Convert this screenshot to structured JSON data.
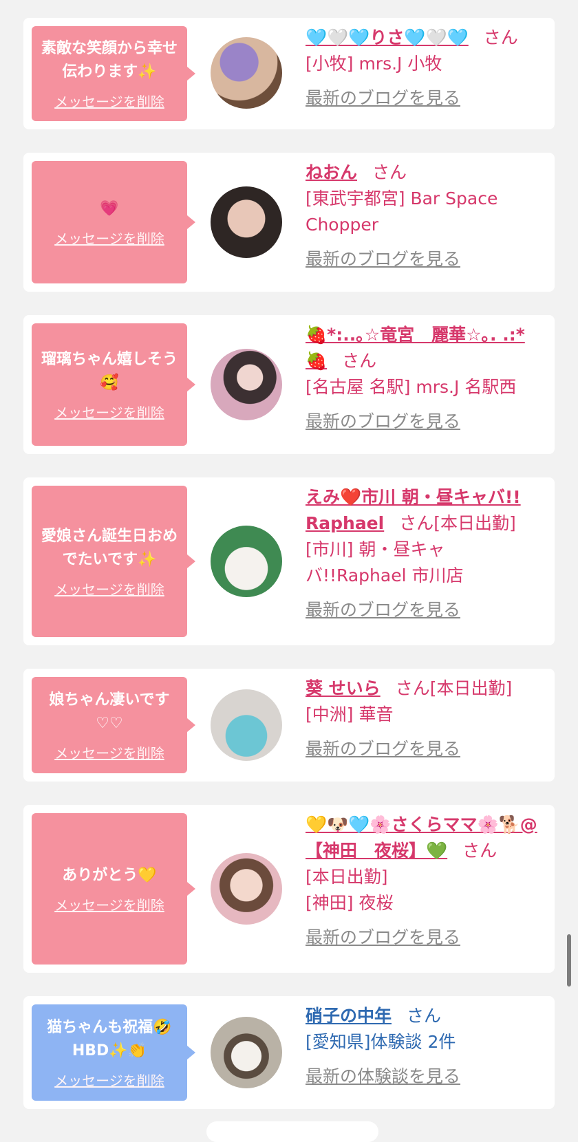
{
  "cards": [
    {
      "message": "素敵な笑顔から幸せ伝わります✨",
      "delete_label": "メッセージを削除",
      "name": "🩵🤍🩵りさ🩵🤍🩵",
      "san": "さん",
      "status": "",
      "shop": "[小牧] mrs.J 小牧",
      "blog_link": "最新のブログを見る",
      "avatar_color": "#8a6a9c"
    },
    {
      "message": "💗",
      "delete_label": "メッセージを削除",
      "name": "ねおん",
      "san": "さん",
      "status": "",
      "shop": "[東武宇都宮] Bar Space Chopper",
      "blog_link": "最新のブログを見る",
      "avatar_color": "#5a4a48"
    },
    {
      "message": "瑠璃ちゃん嬉しそう🥰",
      "delete_label": "メッセージを削除",
      "name": "🍓*:..｡☆竜宮　麗華☆｡. .:*🍓",
      "san": "さん",
      "status": "",
      "shop": "[名古屋 名駅] mrs.J 名駅西",
      "blog_link": "最新のブログを見る",
      "avatar_color": "#b08a9a"
    },
    {
      "message": "愛娘さん誕生日おめでたいです✨",
      "delete_label": "メッセージを削除",
      "name": "えみ❤️市川 朝・昼キャバ!! Raphael",
      "san": "さん",
      "status": "[本日出勤]",
      "shop": "[市川] 朝・昼キャバ!!Raphael 市川店",
      "blog_link": "最新のブログを見る",
      "avatar_color": "#5aa86c"
    },
    {
      "message": "娘ちゃん凄いです♡♡",
      "delete_label": "メッセージを削除",
      "name": "葵 せいら",
      "san": "さん",
      "status": "[本日出勤]",
      "shop": "[中洲] 華音",
      "blog_link": "最新のブログを見る",
      "avatar_color": "#8fc9d6"
    },
    {
      "message": "ありがとう💛",
      "delete_label": "メッセージを削除",
      "name": "💛🐶🩵🌸さくらママ🌸🐕@【神田　夜桜】💚",
      "san": "さん",
      "status": "[本日出勤]",
      "shop": "[神田] 夜桜",
      "blog_link": "最新のブログを見る",
      "avatar_color": "#c79a7a"
    },
    {
      "message": "猫ちゃんも祝福🤣HBD✨👏",
      "delete_label": "メッセージを削除",
      "name": "硝子の中年",
      "san": "さん",
      "status": "",
      "shop": "[愛知県]体験談 2件",
      "blog_link": "最新の体験談を見る",
      "avatar_color": "#a8a49a"
    }
  ],
  "colors": {
    "pink_bubble": "#f5919e",
    "blue_bubble": "#8eb4f3",
    "pink_text": "#d6386b",
    "blue_text": "#2f6ab1",
    "link_grey": "#8a8a8a",
    "background": "#f2f2f2"
  }
}
